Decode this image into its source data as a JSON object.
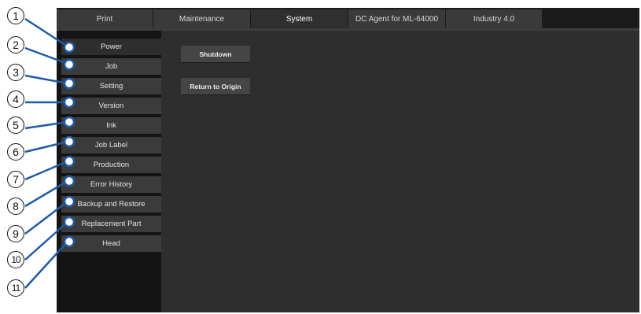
{
  "tabs": [
    {
      "label": "Print"
    },
    {
      "label": "Maintenance"
    },
    {
      "label": "System"
    },
    {
      "label": "DC Agent for ML-64000"
    },
    {
      "label": "Industry 4.0"
    }
  ],
  "sidebar": {
    "items": [
      {
        "label": "Power"
      },
      {
        "label": "Job"
      },
      {
        "label": "Setting"
      },
      {
        "label": "Version"
      },
      {
        "label": "Ink"
      },
      {
        "label": "Job Label"
      },
      {
        "label": "Production"
      },
      {
        "label": "Error History"
      },
      {
        "label": "Backup and Restore"
      },
      {
        "label": "Replacement Part"
      },
      {
        "label": "Head"
      }
    ]
  },
  "content": {
    "shutdown_label": "Shutdown",
    "return_origin_label": "Return to Origin"
  },
  "callouts": [
    "1",
    "2",
    "3",
    "4",
    "5",
    "6",
    "7",
    "8",
    "9",
    "10",
    "11"
  ]
}
